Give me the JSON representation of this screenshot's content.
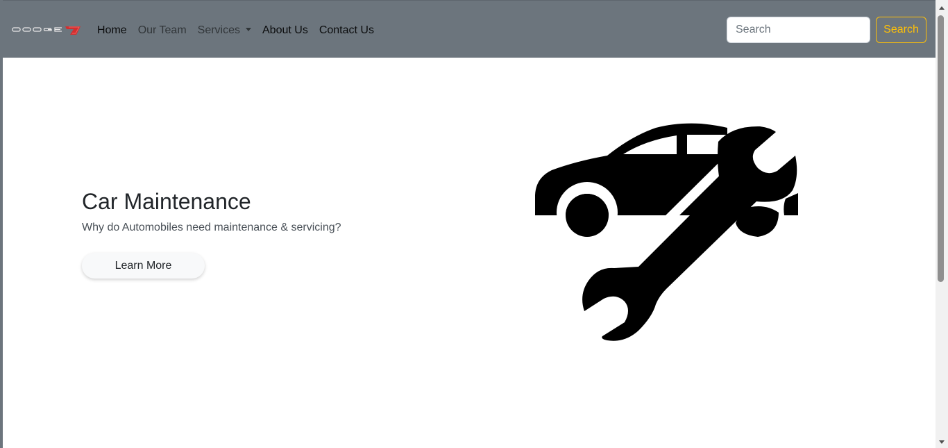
{
  "navbar": {
    "brand_logo": "dodge-logo",
    "links": {
      "home": "Home",
      "our_team": "Our Team",
      "services": "Services",
      "about_us": "About Us",
      "contact_us": "Contact Us"
    },
    "search": {
      "placeholder": "Search",
      "button_label": "Search"
    },
    "colors": {
      "navbar_bg": "#6c757d",
      "search_button_accent": "#ffc107",
      "logo_accent": "#d32f2f"
    }
  },
  "hero": {
    "title": "Car Maintenance",
    "subtitle": "Why do Automobiles need maintenance & servicing?",
    "button_label": "Learn More",
    "illustration_icon": "car-wrench-icon"
  }
}
